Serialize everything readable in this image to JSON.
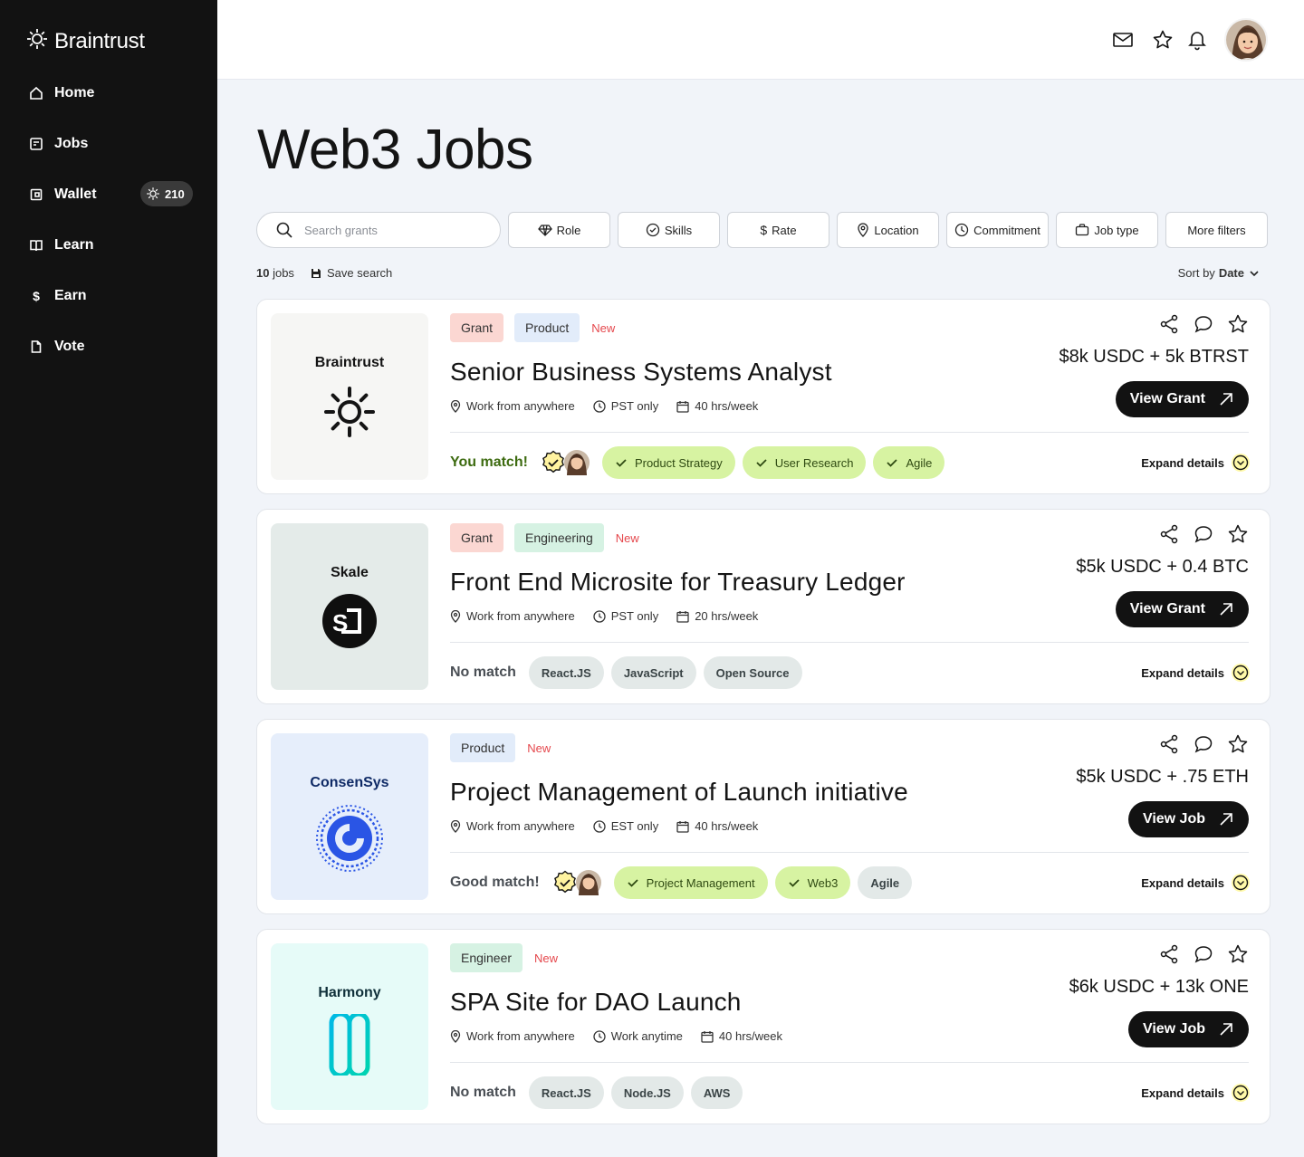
{
  "sidebar": {
    "logo": "Braintrust",
    "items": [
      {
        "label": "Home",
        "icon": "home-icon"
      },
      {
        "label": "Jobs",
        "icon": "jobs-icon"
      },
      {
        "label": "Wallet",
        "icon": "wallet-icon",
        "badge": "210"
      },
      {
        "label": "Learn",
        "icon": "book-icon"
      },
      {
        "label": "Earn",
        "icon": "dollar-icon"
      },
      {
        "label": "Vote",
        "icon": "document-icon"
      }
    ]
  },
  "header": {
    "icons": [
      "mail-icon",
      "star-icon",
      "bell-icon"
    ]
  },
  "page": {
    "title": "Web3 Jobs"
  },
  "filters": {
    "search_placeholder": "Search grants",
    "buttons": [
      "Role",
      "Skills",
      "Rate",
      "Location",
      "Commitment",
      "Job type",
      "More filters"
    ],
    "count_number": "10",
    "count_suffix": " jobs",
    "save_search": "Save search",
    "sort_prefix": "Sort by ",
    "sort_value": "Date"
  },
  "jobs": [
    {
      "company": "Braintrust",
      "tags": [
        "Grant",
        "Product"
      ],
      "new_label": "New",
      "title": "Senior Business Systems Analyst",
      "location": "Work from anywhere",
      "timezone": "PST only",
      "hours": "40 hrs/week",
      "price": "$8k USDC + 5k BTRST",
      "button": "View Grant",
      "match_label": "You match!",
      "skills": [
        "Product Strategy",
        "User Research",
        "Agile"
      ],
      "expand": "Expand details"
    },
    {
      "company": "Skale",
      "tags": [
        "Grant",
        "Engineering"
      ],
      "new_label": "New",
      "title": "Front End Microsite for Treasury Ledger",
      "location": "Work from anywhere",
      "timezone": "PST only",
      "hours": "20 hrs/week",
      "price": "$5k USDC + 0.4 BTC",
      "button": "View Grant",
      "match_label": "No match",
      "skills": [
        "React.JS",
        "JavaScript",
        "Open Source"
      ],
      "expand": "Expand details"
    },
    {
      "company": "ConsenSys",
      "tags": [
        "Product"
      ],
      "new_label": "New",
      "title": "Project Management of Launch initiative",
      "location": "Work from anywhere",
      "timezone": "EST only",
      "hours": "40 hrs/week",
      "price": "$5k USDC + .75 ETH",
      "button": "View Job",
      "match_label": "Good match!",
      "skills": [
        "Project Management",
        "Web3",
        "Agile"
      ],
      "expand": "Expand details"
    },
    {
      "company": "Harmony",
      "tags": [
        "Engineer"
      ],
      "new_label": "New",
      "title": "SPA Site for DAO Launch",
      "location": "Work from anywhere",
      "timezone": "Work anytime",
      "hours": "40 hrs/week",
      "price": "$6k USDC + 13k ONE",
      "button": "View Job",
      "match_label": "No match",
      "skills": [
        "React.JS",
        "Node.JS",
        "AWS"
      ],
      "expand": "Expand details"
    }
  ],
  "colors": {
    "sidebar_bg": "#121212",
    "page_bg": "#f1f4f9",
    "tag_grant": "#fbd7d2",
    "tag_product": "#e2ecfa",
    "tag_engineering": "#d6f2e3",
    "new": "#e5484d",
    "skill_match": "#d7f3a2",
    "skill_nomatch": "#e3e9e8",
    "match_text": "#3d6b10",
    "expand_icon": "#fff9a8"
  }
}
